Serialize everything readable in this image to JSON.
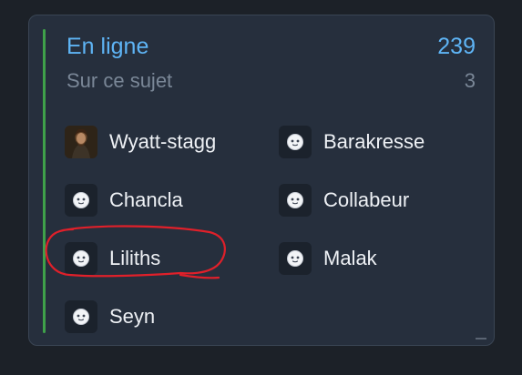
{
  "online": {
    "title": "En ligne",
    "count": "239"
  },
  "topic": {
    "label": "Sur ce sujet",
    "count": "3"
  },
  "users": [
    {
      "name": "Wyatt-stagg",
      "avatar": "portrait-photo"
    },
    {
      "name": "Barakresse",
      "avatar": "default-face-icon"
    },
    {
      "name": "Chancla",
      "avatar": "default-face-icon"
    },
    {
      "name": "Collabeur",
      "avatar": "default-face-icon"
    },
    {
      "name": "Liliths",
      "avatar": "default-face-icon"
    },
    {
      "name": "Malak",
      "avatar": "default-face-icon"
    },
    {
      "name": "Seyn",
      "avatar": "default-face-icon"
    }
  ],
  "colors": {
    "accent": "#5eb4f5",
    "status_bar": "#3fa14a",
    "annotation": "#e0202a"
  }
}
